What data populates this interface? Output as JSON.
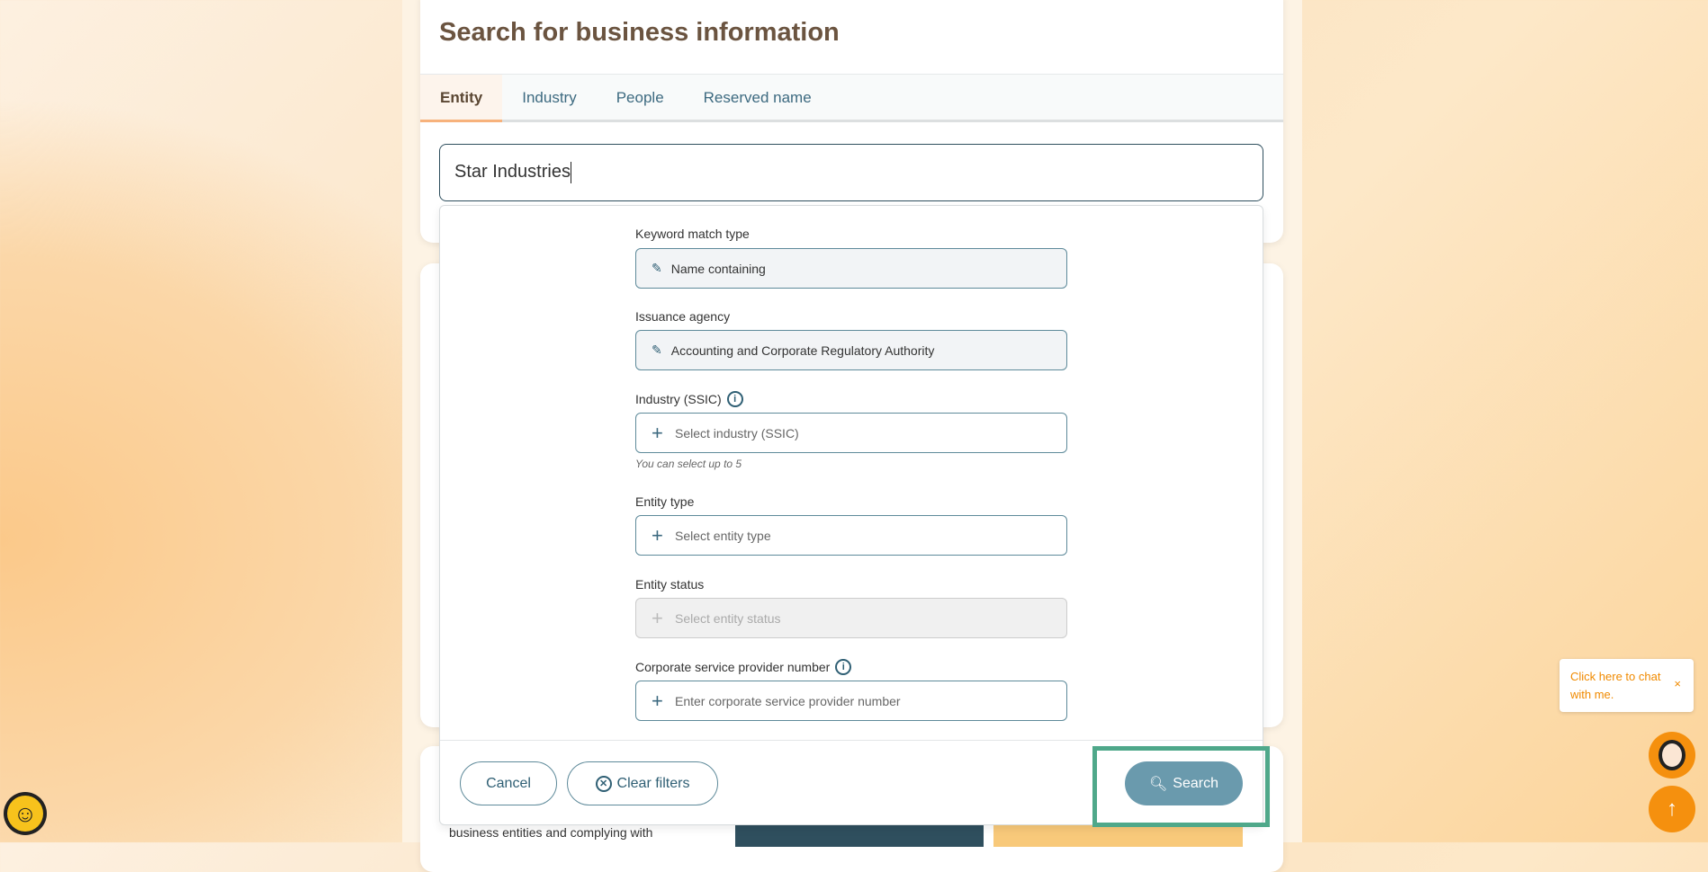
{
  "header": {
    "title": "Search for business information"
  },
  "tabs": [
    {
      "label": "Entity",
      "active": true
    },
    {
      "label": "Industry"
    },
    {
      "label": "People"
    },
    {
      "label": "Reserved name"
    }
  ],
  "search": {
    "value": "Star Industries"
  },
  "filters": {
    "keyword_match": {
      "label": "Keyword match type",
      "value": "Name containing",
      "icon": "pencil-icon"
    },
    "issuance_agency": {
      "label": "Issuance agency",
      "value": "Accounting and Corporate Regulatory Authority",
      "icon": "pencil-icon"
    },
    "industry": {
      "label": "Industry (SSIC)",
      "placeholder": "Select industry (SSIC)",
      "hint": "You can select up to 5"
    },
    "entity_type": {
      "label": "Entity type",
      "placeholder": "Select entity type"
    },
    "entity_status": {
      "label": "Entity status",
      "placeholder": "Select entity status",
      "disabled": true
    },
    "csp": {
      "label": "Corporate service provider number",
      "placeholder": "Enter corporate service provider number"
    }
  },
  "footer": {
    "cancel": "Cancel",
    "clear": "Clear filters",
    "search": "Search"
  },
  "below_card": {
    "text": "business entities and complying with"
  },
  "chat": {
    "text": "Click here to chat with me.",
    "close": "×"
  },
  "colors": {
    "accent": "#6a9aad",
    "highlight": "#4fa88a",
    "chat": "#f5900e"
  }
}
